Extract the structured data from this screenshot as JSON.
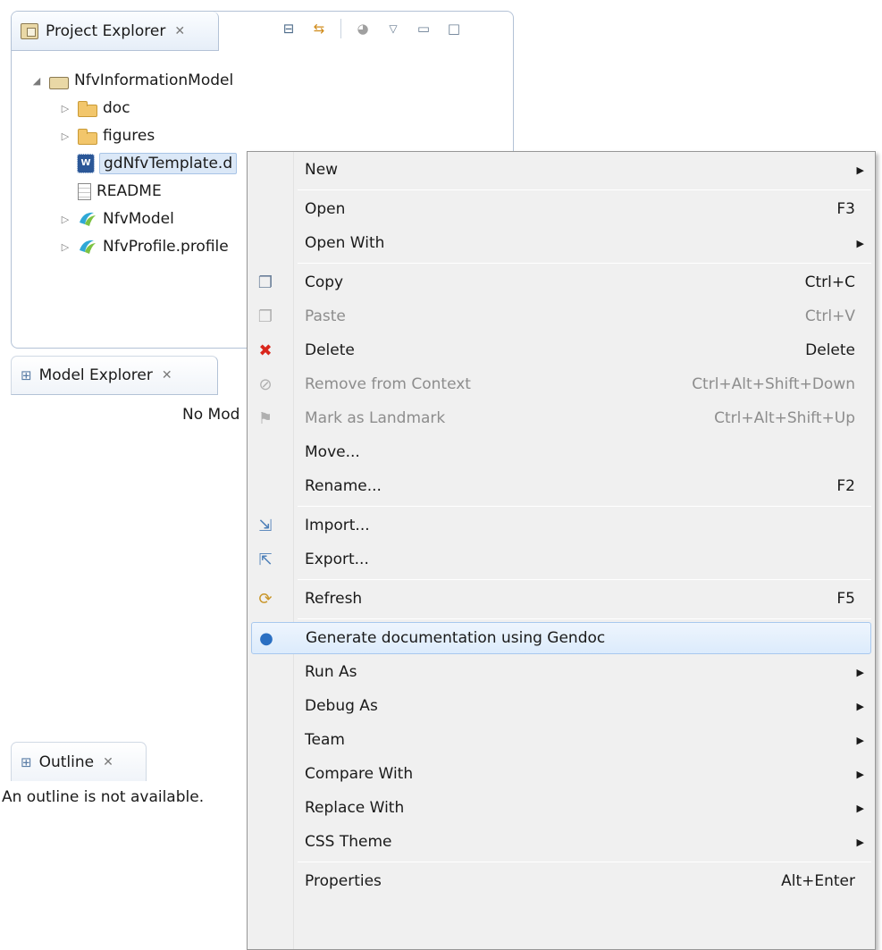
{
  "project_explorer": {
    "tab_label": "Project Explorer",
    "close_glyph": "✕",
    "toolbar_icons": [
      "collapse-all-icon",
      "link-with-editor-icon",
      "filter-icon",
      "view-menu-icon",
      "minimize-icon",
      "maximize-icon"
    ],
    "tree": [
      {
        "label": "NfvInformationModel",
        "icon": "project-folder-icon",
        "twisty": "◢",
        "level": 0
      },
      {
        "label": "doc",
        "icon": "folder-icon",
        "twisty": "▷",
        "level": 1
      },
      {
        "label": "figures",
        "icon": "folder-icon",
        "twisty": "▷",
        "level": 1
      },
      {
        "label": "gdNfvTemplate.d",
        "icon": "word-doc-icon",
        "twisty": "",
        "level": 1
      },
      {
        "label": "README",
        "icon": "text-file-icon",
        "twisty": "",
        "level": 1
      },
      {
        "label": "NfvModel",
        "icon": "papyrus-model-icon",
        "twisty": "▷",
        "level": 1
      },
      {
        "label": "NfvProfile.profile",
        "icon": "papyrus-model-icon",
        "twisty": "▷",
        "level": 1
      }
    ]
  },
  "model_explorer": {
    "tab_label": "Model Explorer",
    "close_glyph": "✕",
    "message": "No Mod"
  },
  "outline": {
    "tab_label": "Outline",
    "close_glyph": "✕",
    "message": "An outline is not available."
  },
  "context_menu": {
    "items": [
      {
        "label": "New",
        "shortcut": "",
        "submenu": true,
        "disabled": false,
        "icon": ""
      },
      {
        "sep": true
      },
      {
        "label": "Open",
        "shortcut": "F3",
        "submenu": false,
        "disabled": false,
        "icon": ""
      },
      {
        "label": "Open With",
        "shortcut": "",
        "submenu": true,
        "disabled": false,
        "icon": ""
      },
      {
        "sep": true
      },
      {
        "label": "Copy",
        "shortcut": "Ctrl+C",
        "submenu": false,
        "disabled": false,
        "icon": "copy-icon"
      },
      {
        "label": "Paste",
        "shortcut": "Ctrl+V",
        "submenu": false,
        "disabled": true,
        "icon": "paste-icon"
      },
      {
        "label": "Delete",
        "shortcut": "Delete",
        "submenu": false,
        "disabled": false,
        "icon": "delete-icon"
      },
      {
        "label": "Remove from Context",
        "shortcut": "Ctrl+Alt+Shift+Down",
        "submenu": false,
        "disabled": true,
        "icon": "remove-context-icon"
      },
      {
        "label": "Mark as Landmark",
        "shortcut": "Ctrl+Alt+Shift+Up",
        "submenu": false,
        "disabled": true,
        "icon": "landmark-icon"
      },
      {
        "label": "Move...",
        "shortcut": "",
        "submenu": false,
        "disabled": false,
        "icon": ""
      },
      {
        "label": "Rename...",
        "shortcut": "F2",
        "submenu": false,
        "disabled": false,
        "icon": ""
      },
      {
        "sep": true
      },
      {
        "label": "Import...",
        "shortcut": "",
        "submenu": false,
        "disabled": false,
        "icon": "import-icon"
      },
      {
        "label": "Export...",
        "shortcut": "",
        "submenu": false,
        "disabled": false,
        "icon": "export-icon"
      },
      {
        "sep": true
      },
      {
        "label": "Refresh",
        "shortcut": "F5",
        "submenu": false,
        "disabled": false,
        "icon": "refresh-icon"
      },
      {
        "sep": true
      },
      {
        "label": "Generate documentation using Gendoc",
        "shortcut": "",
        "submenu": false,
        "disabled": false,
        "icon": "gendoc-icon",
        "hover": true
      },
      {
        "label": "Run As",
        "shortcut": "",
        "submenu": true,
        "disabled": false,
        "icon": ""
      },
      {
        "label": "Debug As",
        "shortcut": "",
        "submenu": true,
        "disabled": false,
        "icon": ""
      },
      {
        "label": "Team",
        "shortcut": "",
        "submenu": true,
        "disabled": false,
        "icon": ""
      },
      {
        "label": "Compare With",
        "shortcut": "",
        "submenu": true,
        "disabled": false,
        "icon": ""
      },
      {
        "label": "Replace With",
        "shortcut": "",
        "submenu": true,
        "disabled": false,
        "icon": ""
      },
      {
        "label": "CSS Theme",
        "shortcut": "",
        "submenu": true,
        "disabled": false,
        "icon": ""
      },
      {
        "sep": true
      },
      {
        "label": "Properties",
        "shortcut": "Alt+Enter",
        "submenu": false,
        "disabled": false,
        "icon": ""
      }
    ]
  },
  "colors": {
    "pane_border": "#b3c2d6",
    "menu_bg": "#f0f0f0",
    "hover_border": "#a8c8ee",
    "disabled_text": "#8d8d8d",
    "delete_red": "#d9261c",
    "gendoc_blue": "#2a6fc2"
  }
}
